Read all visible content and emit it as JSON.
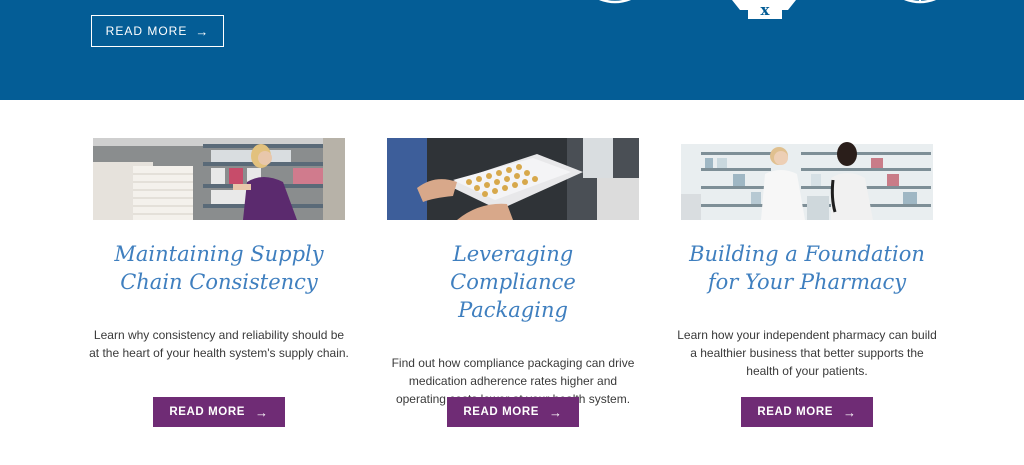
{
  "hero": {
    "read_more_label": "READ MORE",
    "arrow": "→",
    "background_color": "#045d96",
    "icons": [
      "circle-icon",
      "prescription-icon",
      "globe-icon"
    ],
    "prescription_glyph": "x"
  },
  "cards": [
    {
      "image_subject": "warehouse-worker-stocking-shelves",
      "title_line1": "Maintaining Supply",
      "title_line2": "Chain Consistency",
      "body": "Learn why consistency and reliability should be at the heart of your health system's supply chain.",
      "button_label": "READ MORE",
      "arrow": "→"
    },
    {
      "image_subject": "hands-holding-blister-pack",
      "title_line1": "Leveraging Compliance",
      "title_line2": "Packaging",
      "body": "Find out how compliance packaging can drive medication adherence rates higher and operating costs lower at your health system.",
      "button_label": "READ MORE",
      "arrow": "→"
    },
    {
      "image_subject": "pharmacist-with-customer",
      "title_line1": "Building a Foundation",
      "title_line2": "for Your Pharmacy",
      "body": "Learn how your independent pharmacy can build a healthier business that better supports the health of your patients.",
      "button_label": "READ MORE",
      "arrow": "→"
    }
  ],
  "colors": {
    "title_blue": "#3f7fbf",
    "button_purple": "#6f2c75",
    "body_text": "#3a3a3a"
  }
}
